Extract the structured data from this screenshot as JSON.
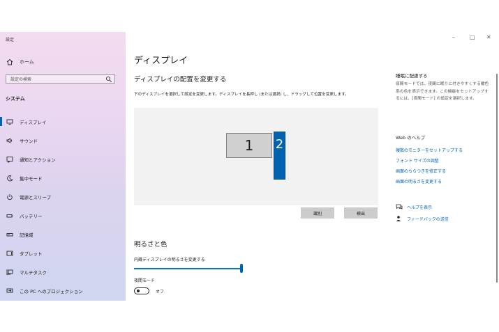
{
  "window": {
    "title": "設定",
    "controls": {
      "minimize": "–",
      "maximize": "□",
      "close": "✕"
    }
  },
  "sidebar": {
    "home_label": "ホーム",
    "search_placeholder": "設定の検索",
    "section_title": "システム",
    "items": [
      {
        "label": "ディスプレイ",
        "icon": "monitor-icon",
        "active": true
      },
      {
        "label": "サウンド",
        "icon": "speaker-icon"
      },
      {
        "label": "通知とアクション",
        "icon": "notification-icon"
      },
      {
        "label": "集中モード",
        "icon": "moon-icon"
      },
      {
        "label": "電源とスリープ",
        "icon": "power-icon"
      },
      {
        "label": "バッテリー",
        "icon": "battery-icon"
      },
      {
        "label": "記憶域",
        "icon": "storage-icon"
      },
      {
        "label": "タブレット",
        "icon": "tablet-icon"
      },
      {
        "label": "マルチタスク",
        "icon": "multitask-icon"
      },
      {
        "label": "この PC へのプロジェクション",
        "icon": "projection-icon"
      }
    ]
  },
  "main": {
    "page_title": "ディスプレイ",
    "arrange_title": "ディスプレイの配置を変更する",
    "arrange_instructions": "下のディスプレイを選択して設定を変更します。ディスプレイを長押し (または選択) し、ドラッグして位置を変更します。",
    "monitors": [
      "1",
      "2"
    ],
    "identify_button": "識別",
    "detect_button": "検出",
    "brightness_title": "明るさと色",
    "brightness_label": "内蔵ディスプレイの明るさを変更する",
    "brightness_value": 1.0,
    "night_light_label": "夜間モード",
    "night_light_state": "オフ"
  },
  "right_panel": {
    "sleep_heading": "睡眠に配慮する",
    "sleep_text": "夜間モードでは、夜間に眠りに付きやすくする暖色系の色を表示できます。この機能をセットアップするには、[夜間モード] の設定を選択します。",
    "web_help_heading": "Web のヘルプ",
    "links": [
      "複数のモニターをセットアップする",
      "フォント サイズの調整",
      "画面のちらつきを修正する",
      "画面の明るさを変更する"
    ],
    "get_help": "ヘルプを表示",
    "feedback": "フィードバックの送信"
  },
  "colors": {
    "accent": "#0063b1",
    "accent_light": "#0078d7",
    "link": "#0063b1"
  }
}
